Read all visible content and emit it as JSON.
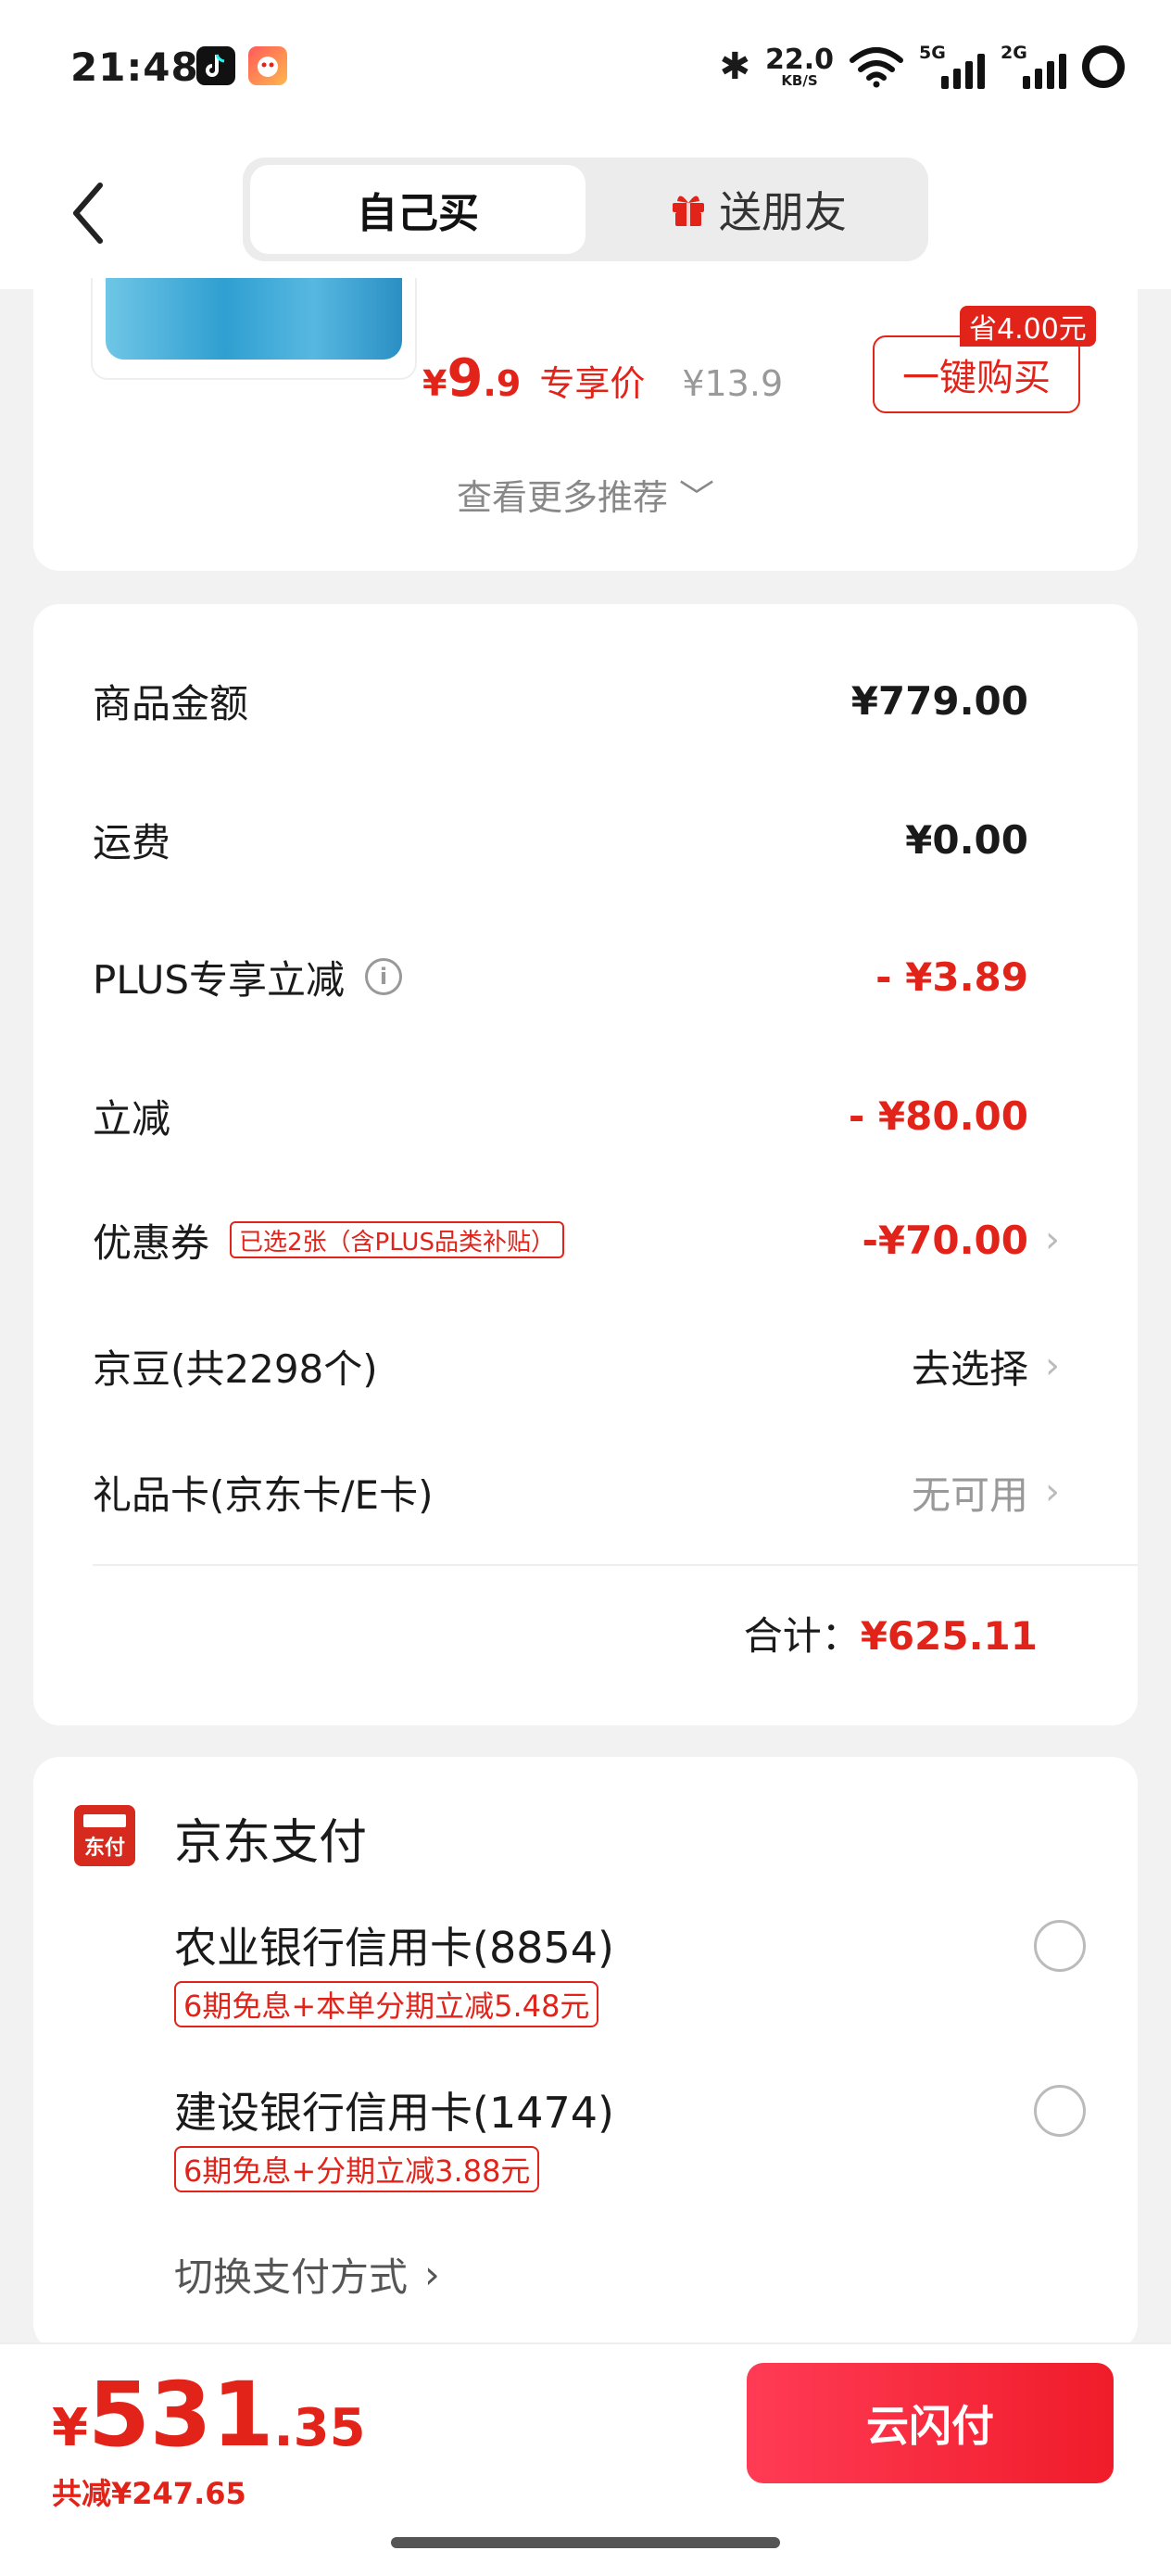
{
  "status": {
    "time": "21:48",
    "speed": "22.0",
    "speed_unit": "KB/S",
    "net1": "5G",
    "net2": "2G"
  },
  "header": {
    "tab_self": "自己买",
    "tab_gift": "送朋友"
  },
  "recommend": {
    "price_symbol": "¥",
    "price_int": "9",
    "price_dec": ".9",
    "price_tag": "专享价",
    "old_price": "¥13.9",
    "save_badge": "省4.00元",
    "buy_label": "一键购买",
    "more_label": "查看更多推荐"
  },
  "summary": {
    "goods_label": "商品金额",
    "goods_value": "¥779.00",
    "freight_label": "运费",
    "freight_value": "¥0.00",
    "plus_label": "PLUS专享立减",
    "plus_value": "- ¥3.89",
    "discount_label": "立减",
    "discount_value": "- ¥80.00",
    "coupon_label": "优惠券",
    "coupon_tag": "已选2张（含PLUS品类补贴）",
    "coupon_value": "-¥70.00",
    "beans_label": "京豆(共2298个)",
    "beans_value": "去选择",
    "giftcard_label": "礼品卡(京东卡/E卡)",
    "giftcard_value": "无可用",
    "total_label": "合计：",
    "total_value": "¥625.11"
  },
  "payment": {
    "logo_text": "东付",
    "title": "京东支付",
    "bank1": "农业银行信用卡(8854)",
    "bank1_promo": "6期免息+本单分期立减5.48元",
    "bank2": "建设银行信用卡(1474)",
    "bank2_promo": "6期免息+分期立减3.88元",
    "switch_label": "切换支付方式"
  },
  "footer": {
    "price_symbol": "¥",
    "price_int": "531",
    "price_dec": ".35",
    "saved": "共减¥247.65",
    "pay_button": "云闪付"
  },
  "colors": {
    "accent": "#e2231a",
    "pay_button": "#f01c2a",
    "background": "#f2f2f2"
  }
}
